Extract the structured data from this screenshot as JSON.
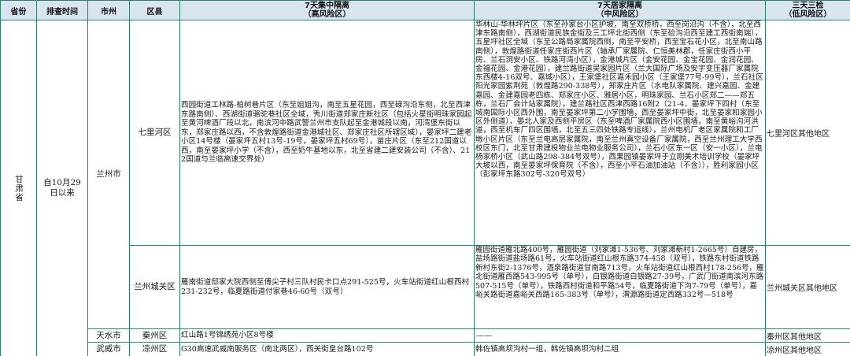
{
  "headers": {
    "province": "省份",
    "time": "排查时间",
    "city": "市州",
    "county": "区县",
    "high_line1": "7天集中隔离",
    "high_line2": "（高风险区）",
    "mid_line1": "7天居家隔离",
    "mid_line2": "（中风险区）",
    "low_line1": "三天三检",
    "low_line2": "（低风险区）"
  },
  "province": "甘肃省",
  "time": "自10月29日以来",
  "rows": {
    "lanzhou": {
      "city": "兰州市",
      "qilihe": {
        "county": "七里河区",
        "high": "西园街道工林路-柏树巷片区（东至姐姐沟，南至五星花园，西至碌沟沿东侧，北至西津东路南侧）、西湖街道骆驼巷社区全域，秀川街道郑家庄新社区（包括火星街明珠家园起至黄河啤酒厂段以北，南滨河中路武警兰州市支队起至金港城段以南，河湾堡东街以东，郑家庄路以西，不含敦煌路街道金港城社区、郑家庄社区所辖区域），晏家坪二建老小区14号楼（晏家坪五村13号-19号，晏家坪五村69号），苗庄片区（东至212国道以西，南至晏家坪小学（不含），西至奶牛基地以东，北至省建二建安装公司（不含）、212国道与兰临高速交界处）",
        "mid": "华林山-华林坪片区（东至孙家台小区护坡，南至双桥桥，西至岗沿沟（不含），北至西津东路南侧），西湖街道民族金街及三工坪北街西侧（东至硷沟沿西至建工西街南端），五星坪社区全域（东至公路局家属院西侧，南至平安桥，西至宝石花小区，北至南山路南侧），敦煌路街道任家庄街西片区（轴承厂家属院、仁恒美林郡，任家庄街西小平房、兰石洞安小区、铁路河湾小区），金港城片区（金安花园、金宝花园、金润花园、金福花园、金港花园），建兰路街道吴家园片区（兰大国际广场及安宇变压器厂家属院东西楼4-16双号、嘉城小区），王家堡社区嘉禾园小区（王家堡77号-99号），兰石社区阳光家园紫荆苑（敦煌路290-338号），郑家庄片区（水电队家属院、建兴嘉园、金建嘉园、金建嘉园老四栋、郑家庄小区、雅居小区，明珠家园、兰石小区郑二——郑五栋，兰石厂会计站家属院），建兰路社区西津西路16附2（21-4、晏家坪下四村（东至城南国际小区西外围，南至晏家坪第二小学围墙，西至晏家坪中街，北至晏家和家园小区外侧道），晏北人家及西侧平房区（东至啤酒厂家属院西小区围墙，南至黄峪沟河洪道，西至机车厂四区围墙，北至五三四处铁路专运线），兰州电机厂老区家属院和工厂墩小区片区（东至兰电高层家属院，南至兰州真空设备厂家属院，西至兰州理工大学西校区东门，北至甘肃建投物业兰电物业服务公司），兰石小区东一区（安一小区），兰电杨家桥小区（武山路298-384号双号），西果园镇晏家坪于立刚美术培训学校（晏家坪大坡以西，南至晏家坪保育院（不含），西至小平石油加油站（不含）），胜利家园小区（彭家坪东路302号-320号双号）",
        "low": "七里河区其他地区"
      },
      "chengguan": {
        "county": "兰州城关区",
        "high": "雁南街道邸家大院西侧至傅尖子村三队村民卡口点291-525号，火车站街道红山根西村231-232号，临夏路街道付家巷46-60号（双号）",
        "mid": "雁园街道雁北路400号，雁园街道（刘家滩1-536号、刘家滩新村1-2665号）自建房，盐场路街道盐场路61号，火车站街道红山根东路374-458（双号），铁路东村街道铁路新村东街2-1376号，酒泉路街道甘南路713号，火车站街道红山根西村178-256号，雁北街道雁西路543-995号（单号），白银路街道白银路27-39号，广武门街道南滨河东路507-515号（单号），铁路西村街道和平路54号，临夏路街道下沟7-79号（单号），嘉峪关路街道嘉峪关西路165-383号（单号），渭源路街道定西路332号—518号",
        "low": "兰州城关区其他地区"
      }
    },
    "tianshui": {
      "city": "天水市",
      "county": "秦州区",
      "high": "红山路1号锦绣苑小区8号楼",
      "mid": "——",
      "low": "秦州区其他地区"
    },
    "wuwei": {
      "city": "武威市",
      "county": "凉州区",
      "high": "G30高速武威南服务区（南北两区），西关街皇台路102号",
      "mid": "韩佐镇高坝沟村一组，韩佐镇高坝沟村二组",
      "low": "凉州区其他地区"
    }
  }
}
